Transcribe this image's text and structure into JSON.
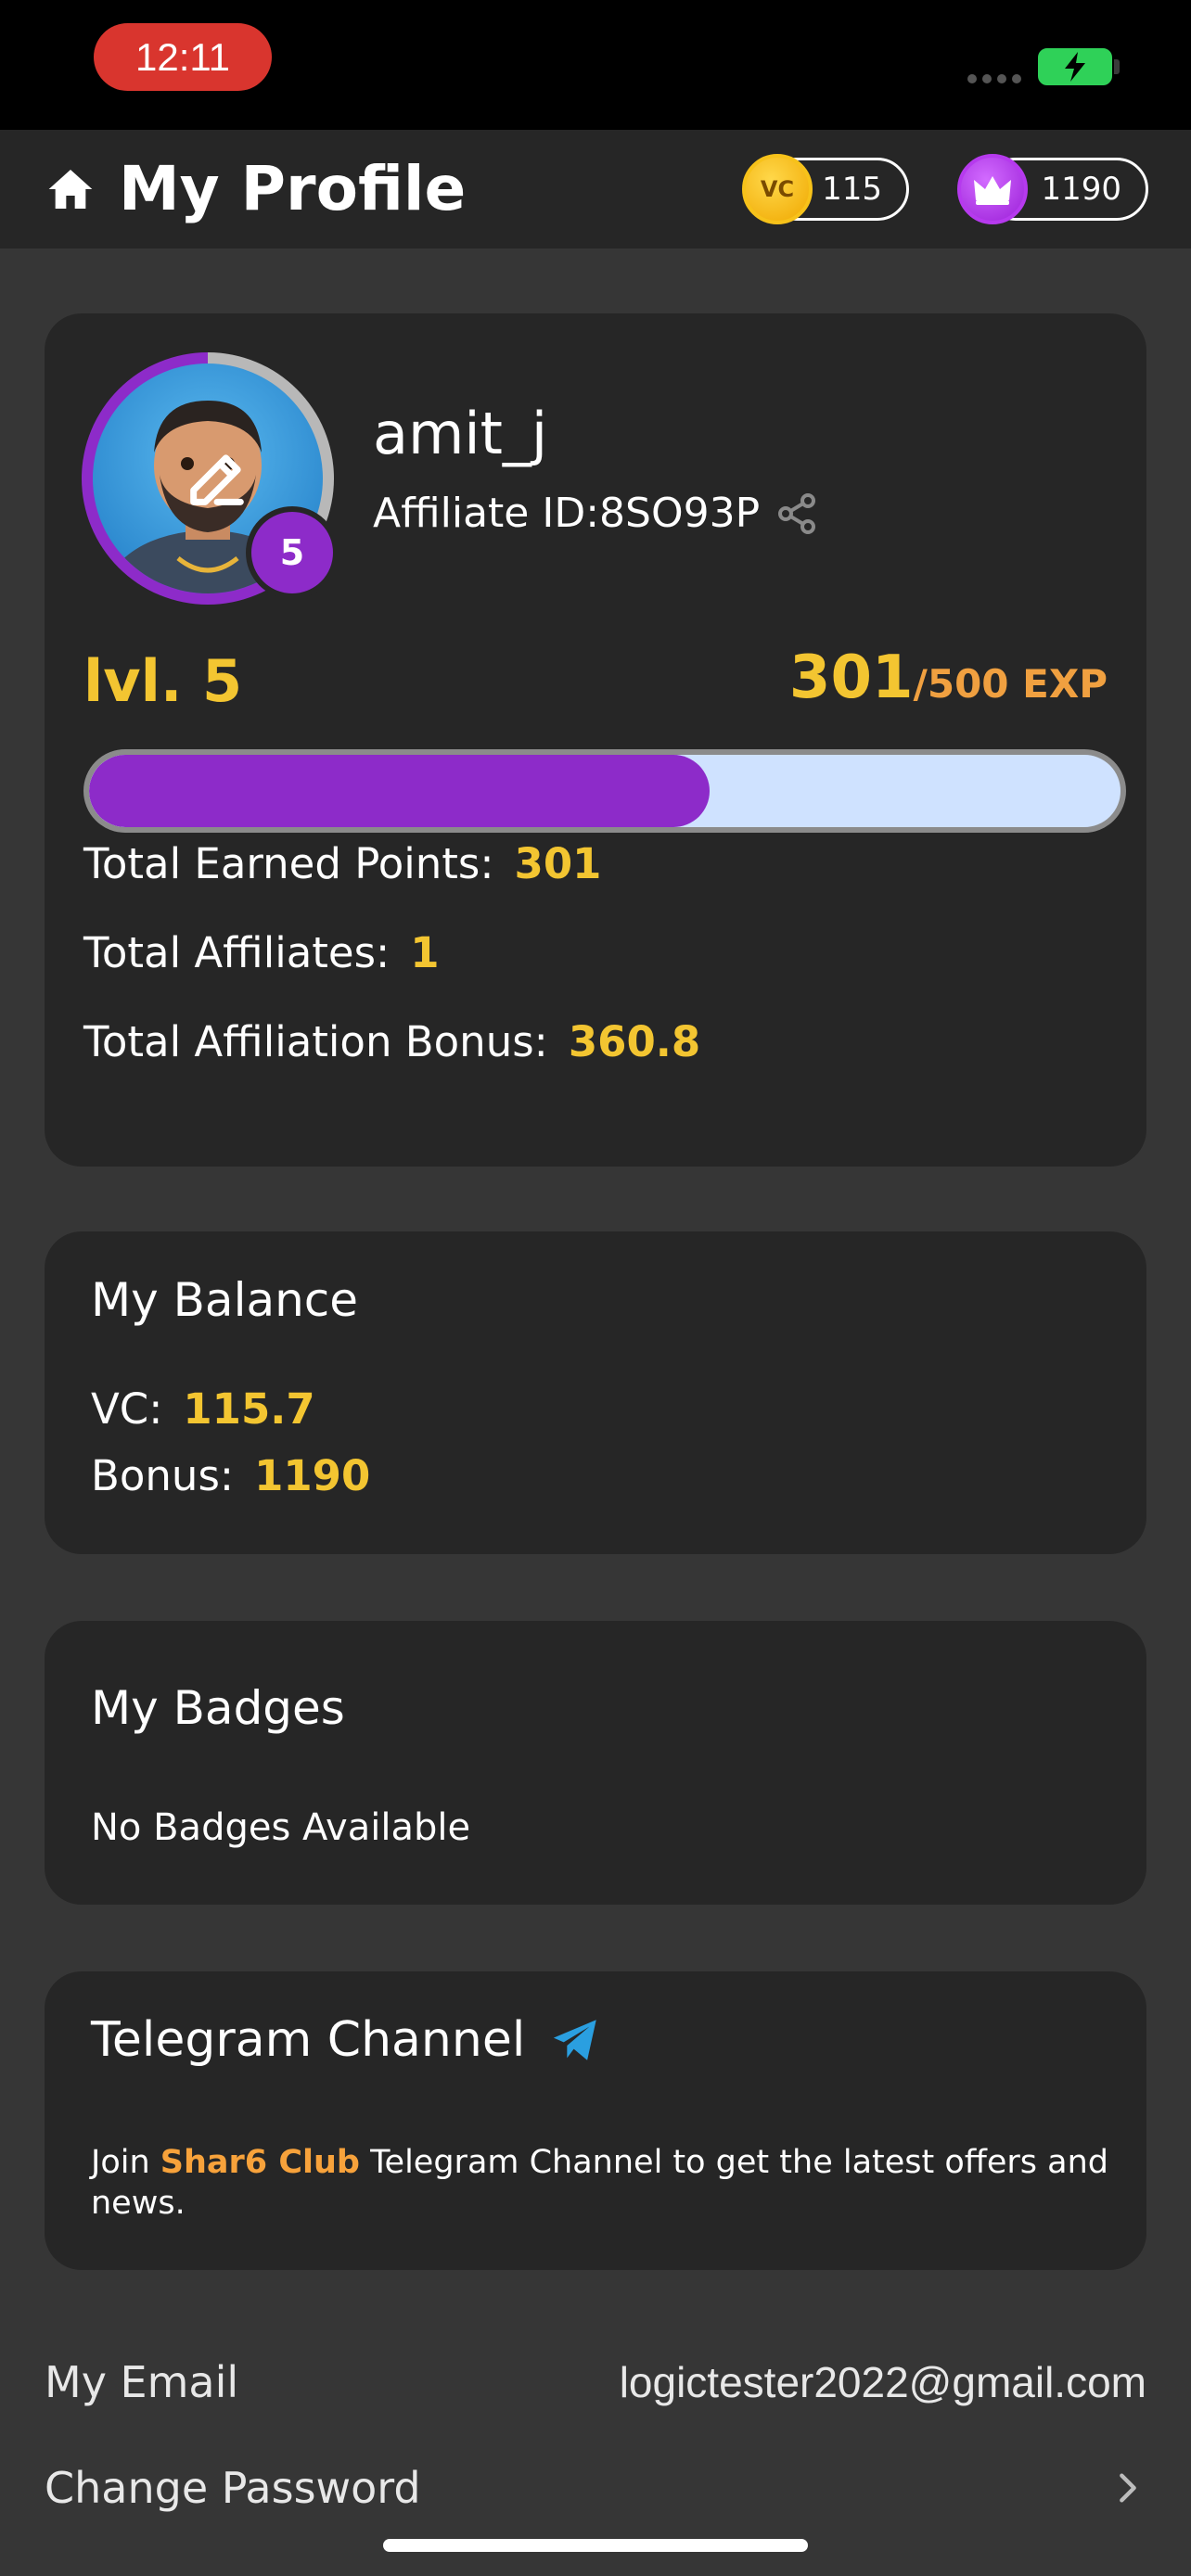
{
  "status_bar": {
    "time": "12:11"
  },
  "header": {
    "title": "My Profile",
    "vc_coin_label": "VC",
    "vc_balance": "115",
    "bonus_balance": "1190"
  },
  "profile": {
    "username": "amit_j",
    "affiliate_label": "Affiliate ID:",
    "affiliate_id": "8SO93P",
    "avatar_level": "5",
    "level_text": "lvl. 5",
    "exp_current": "301",
    "exp_total": "/500 EXP",
    "exp_progress_fraction": 0.602,
    "stats": [
      {
        "label": "Total Earned Points:",
        "value": "301"
      },
      {
        "label": "Total Affiliates:",
        "value": "1"
      },
      {
        "label": "Total Affiliation Bonus:",
        "value": "360.8"
      }
    ]
  },
  "balance": {
    "title": "My Balance",
    "vc_label": "VC:",
    "vc_value": "115.7",
    "bonus_label": "Bonus:",
    "bonus_value": "1190"
  },
  "badges": {
    "title": "My Badges",
    "empty_text": "No Badges Available"
  },
  "telegram": {
    "title": "Telegram Channel",
    "desc_prefix": "Join ",
    "brand": "Shar6 Club",
    "desc_suffix": " Telegram Channel to get the latest offers and news."
  },
  "account": {
    "email_label": "My Email",
    "email_value": "logictester2022@gmail.com",
    "password_label": "Change Password"
  },
  "colors": {
    "accent_purple": "#8d2bc9",
    "accent_yellow": "#f3c531",
    "brand_orange": "#f7a23b",
    "card_bg": "#262626",
    "page_bg": "#363636"
  }
}
